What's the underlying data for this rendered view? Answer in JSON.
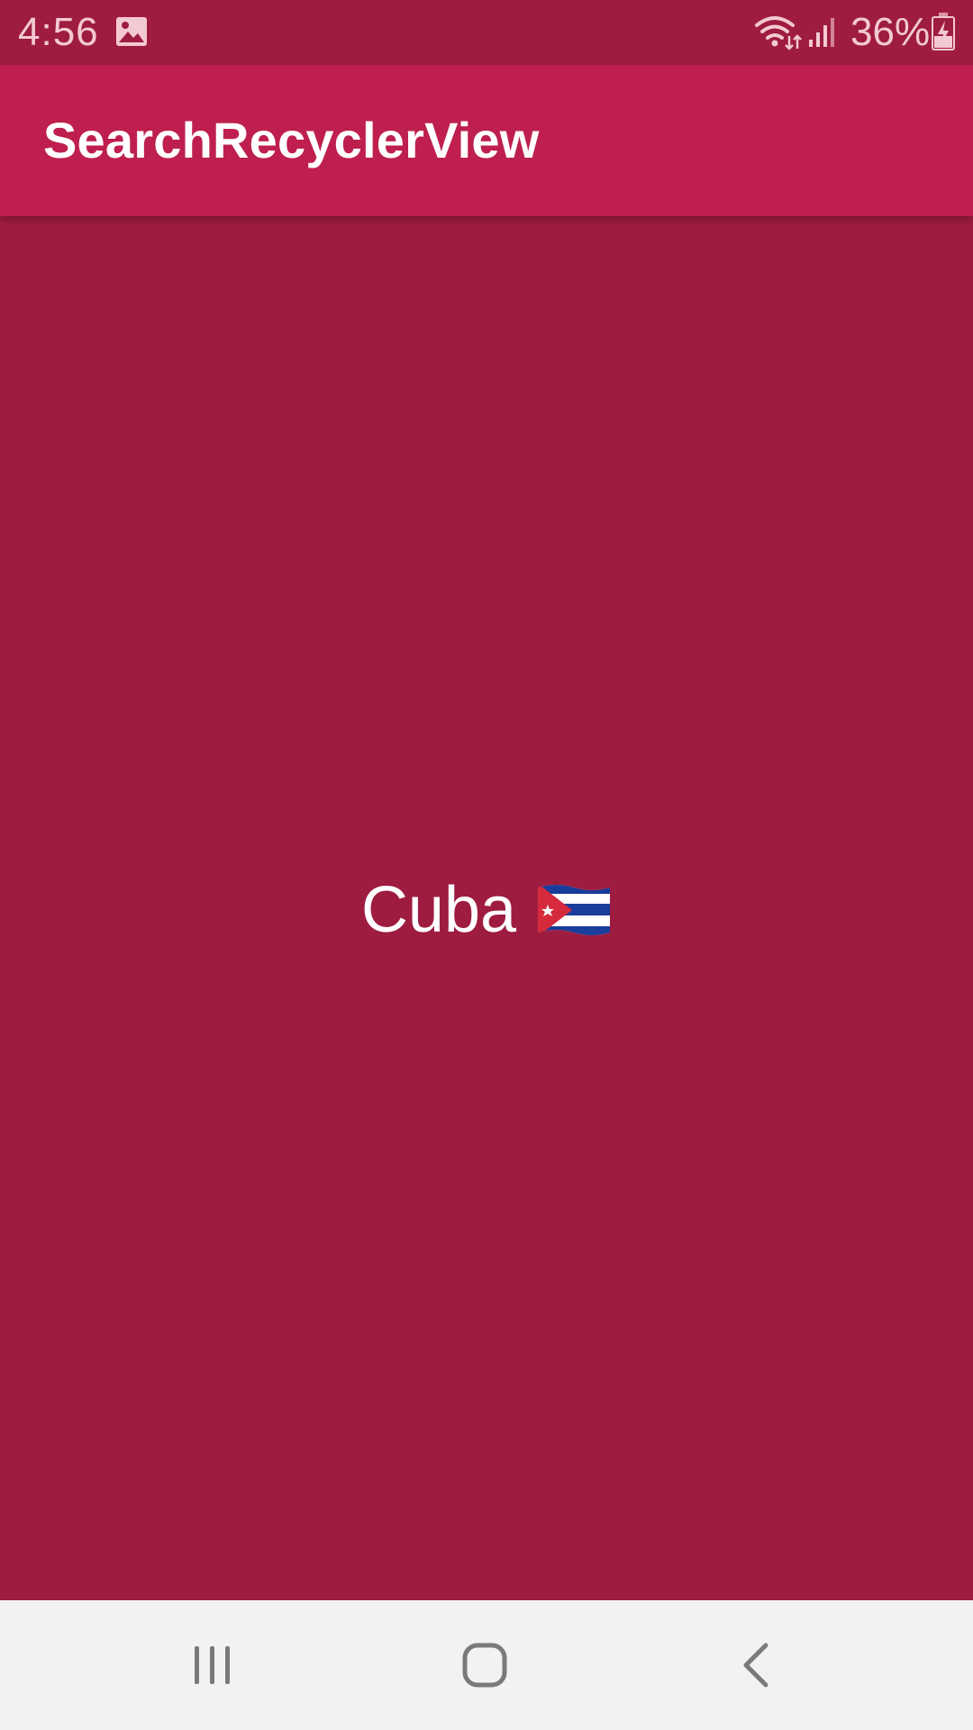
{
  "status_bar": {
    "time": "4:56",
    "battery_percent": "36%",
    "icons": [
      "gallery-icon",
      "wifi-icon",
      "signal-icon",
      "battery-charging-icon"
    ]
  },
  "app_bar": {
    "title": "SearchRecyclerView"
  },
  "content": {
    "country_name": "Cuba",
    "flag_icon": "cuba-flag-icon"
  },
  "nav_bar": {
    "buttons": [
      "recents",
      "home",
      "back"
    ]
  },
  "colors": {
    "status_bar": "#9e1c3f",
    "app_bar": "#be1f4e",
    "background": "#9e1c3f",
    "nav_bar": "#f2f2f2",
    "text": "#ffffff"
  }
}
